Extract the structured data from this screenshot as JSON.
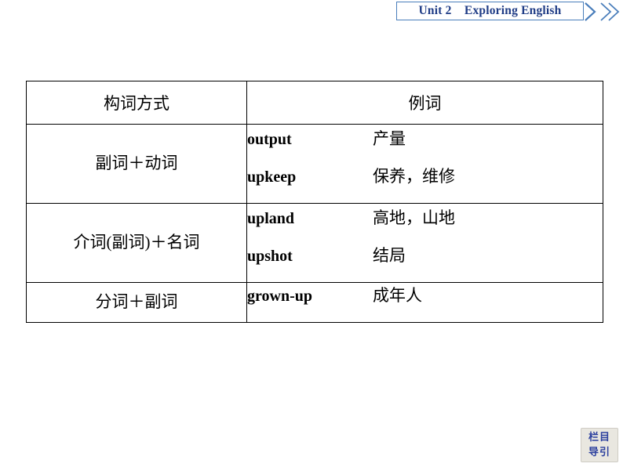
{
  "header": {
    "unit_label": "Unit 2",
    "title": "Exploring English",
    "full_title": "Unit 2    Exploring English",
    "accent_color": "#4a7ebb",
    "text_color": "#1f3c86",
    "chevron_icon": "double-chevron-right"
  },
  "table": {
    "columns": [
      {
        "key": "method",
        "header": "构词方式"
      },
      {
        "key": "examples",
        "header": "例词"
      }
    ],
    "rows": [
      {
        "method": "副词＋动词",
        "examples": [
          {
            "word": "output",
            "gloss": "产量"
          },
          {
            "word": "upkeep",
            "gloss": "保养，维修"
          }
        ]
      },
      {
        "method": "介词(副词)＋名词",
        "examples": [
          {
            "word": "upland",
            "gloss": "高地，山地"
          },
          {
            "word": "upshot",
            "gloss": "结局"
          }
        ]
      },
      {
        "method": "分词＋副词",
        "examples": [
          {
            "word": "grown-up",
            "gloss": "成年人"
          }
        ]
      }
    ]
  },
  "nav_badge": {
    "line1": "栏目",
    "line2": "导引",
    "text_color": "#2b3f9e",
    "background_color": "#e9e7e0"
  }
}
